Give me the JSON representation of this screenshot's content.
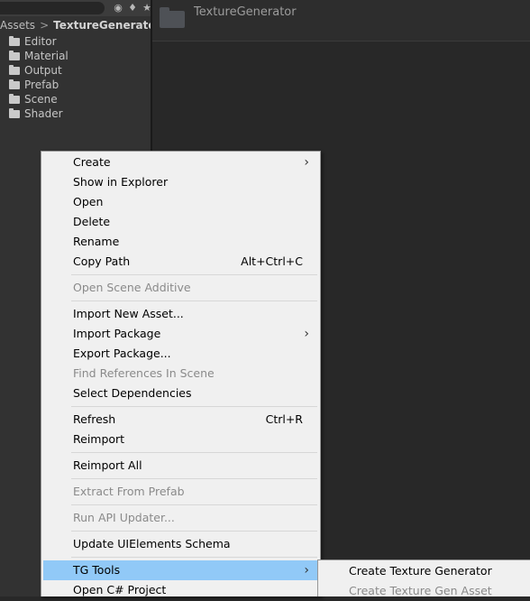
{
  "project_panel": {
    "breadcrumb": {
      "root": "Assets",
      "separator": ">",
      "current": "TextureGenerato"
    },
    "folders": [
      "Editor",
      "Material",
      "Output",
      "Prefab",
      "Scene",
      "Shader"
    ],
    "toolbar_icons": [
      "search-by-type-icon",
      "label-icon",
      "star-icon"
    ]
  },
  "content_panel": {
    "folder_name": "TextureGenerator"
  },
  "context_menu": {
    "items": [
      {
        "label": "Create",
        "submenu": true
      },
      {
        "label": "Show in Explorer"
      },
      {
        "label": "Open"
      },
      {
        "label": "Delete"
      },
      {
        "label": "Rename"
      },
      {
        "label": "Copy Path",
        "shortcut": "Alt+Ctrl+C"
      },
      {
        "label": "Open Scene Additive",
        "disabled": true
      },
      {
        "label": "Import New Asset..."
      },
      {
        "label": "Import Package",
        "submenu": true
      },
      {
        "label": "Export Package..."
      },
      {
        "label": "Find References In Scene",
        "disabled": true
      },
      {
        "label": "Select Dependencies"
      },
      {
        "label": "Refresh",
        "shortcut": "Ctrl+R"
      },
      {
        "label": "Reimport"
      },
      {
        "label": "Reimport All"
      },
      {
        "label": "Extract From Prefab",
        "disabled": true
      },
      {
        "label": "Run API Updater...",
        "disabled": true
      },
      {
        "label": "Update UIElements Schema"
      },
      {
        "label": "TG Tools",
        "submenu": true,
        "highlighted": true
      },
      {
        "label": "Open C# Project"
      }
    ]
  },
  "submenu": {
    "items": [
      {
        "label": "Create Texture Generator"
      },
      {
        "label": "Create Texture Gen Asset",
        "disabled": true
      }
    ]
  },
  "colors": {
    "highlight": "#91c9f7",
    "menu_bg": "#f0f0f0",
    "panel_bg": "#323232"
  }
}
